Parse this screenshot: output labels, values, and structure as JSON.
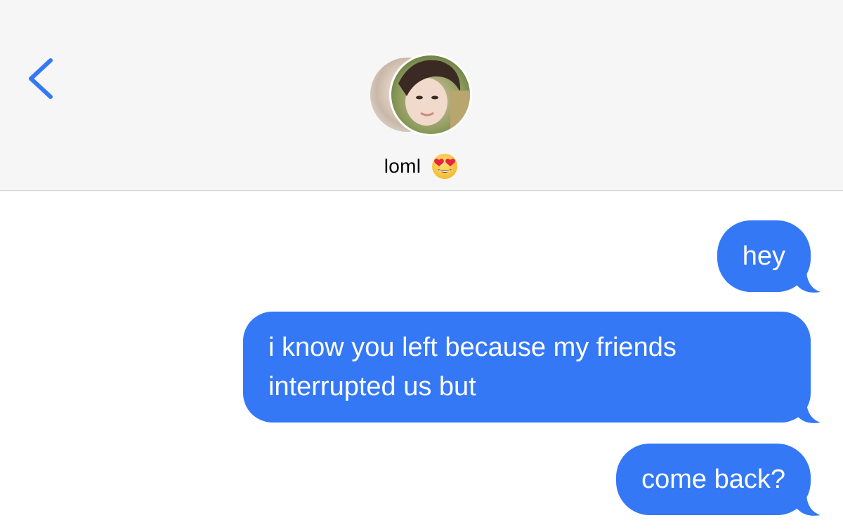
{
  "header": {
    "contact_name": "loml",
    "back_icon": "chevron-left-icon",
    "name_emoji": "heart-eyes-emoji",
    "accent_color": "#3478f6",
    "background_color": "#f6f6f6"
  },
  "messages": [
    {
      "direction": "outgoing",
      "text": "hey"
    },
    {
      "direction": "outgoing",
      "text": "i know you left because my friends\ninterrupted us but"
    },
    {
      "direction": "outgoing",
      "text": "come back?"
    }
  ],
  "bubble_color": "#3478f6"
}
